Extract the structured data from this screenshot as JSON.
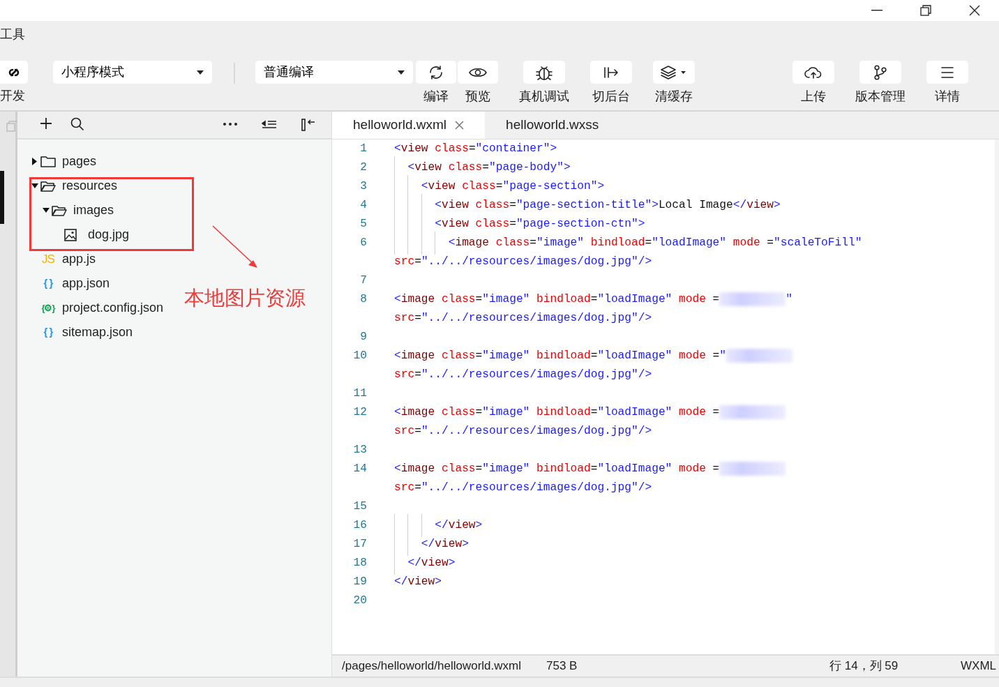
{
  "window": {
    "title": "工具"
  },
  "toolbar": {
    "left_label": "开发",
    "dropdowns": [
      {
        "kind": "mode",
        "value": "小程序模式"
      },
      {
        "kind": "compile",
        "value": "普通编译"
      }
    ],
    "buttons": [
      {
        "kind": "refresh",
        "label": "编译"
      },
      {
        "kind": "eye",
        "label": "预览"
      },
      {
        "kind": "bug",
        "label": "真机调试"
      },
      {
        "kind": "switch",
        "label": "切后台"
      },
      {
        "kind": "layers",
        "label": "清缓存"
      },
      {
        "kind": "cloud",
        "label": "上传"
      },
      {
        "kind": "branch",
        "label": "版本管理"
      },
      {
        "kind": "menu",
        "label": "详情"
      }
    ]
  },
  "file_tree": [
    {
      "kind": "folder",
      "label": "pages",
      "expanded": false
    },
    {
      "kind": "folder",
      "label": "resources",
      "expanded": true,
      "children": [
        {
          "kind": "folder",
          "label": "images",
          "expanded": true,
          "children": [
            {
              "kind": "image",
              "label": "dog.jpg"
            }
          ]
        }
      ]
    },
    {
      "kind": "js",
      "icon_text": "JS",
      "label": "app.js"
    },
    {
      "kind": "json",
      "icon_text": "{ }",
      "label": "app.json"
    },
    {
      "kind": "config",
      "icon_text": "{⚙}",
      "label": "project.config.json"
    },
    {
      "kind": "json",
      "icon_text": "{ }",
      "label": "sitemap.json"
    }
  ],
  "annotation": {
    "label": "本地图片资源"
  },
  "tabs": [
    {
      "label": "helloworld.wxml",
      "selected": true
    },
    {
      "label": "helloworld.wxss",
      "selected": false
    }
  ],
  "code_lines": [
    {
      "number": "1",
      "tokens": [
        {
          "kind": "bracket",
          "text": "<"
        },
        {
          "kind": "tag",
          "text": "view"
        },
        {
          "kind": "attr",
          "text": " class"
        },
        {
          "kind": "plain",
          "text": "="
        },
        {
          "kind": "string",
          "text": "\"container\""
        },
        {
          "kind": "bracket",
          "text": ">"
        }
      ]
    },
    {
      "number": "2",
      "tokens": [
        {
          "kind": "bracket",
          "text": "  <"
        },
        {
          "kind": "tag",
          "text": "view"
        },
        {
          "kind": "attr",
          "text": " class"
        },
        {
          "kind": "plain",
          "text": "="
        },
        {
          "kind": "string",
          "text": "\"page-body\""
        },
        {
          "kind": "bracket",
          "text": ">"
        }
      ]
    },
    {
      "number": "3",
      "tokens": [
        {
          "kind": "bracket",
          "text": "    <"
        },
        {
          "kind": "tag",
          "text": "view"
        },
        {
          "kind": "attr",
          "text": " class"
        },
        {
          "kind": "plain",
          "text": "="
        },
        {
          "kind": "string",
          "text": "\"page-section\""
        },
        {
          "kind": "bracket",
          "text": ">"
        }
      ]
    },
    {
      "number": "4",
      "tokens": [
        {
          "kind": "bracket",
          "text": "      <"
        },
        {
          "kind": "tag",
          "text": "view"
        },
        {
          "kind": "attr",
          "text": " class"
        },
        {
          "kind": "plain",
          "text": "="
        },
        {
          "kind": "string",
          "text": "\"page-section-title\""
        },
        {
          "kind": "bracket",
          "text": ">"
        },
        {
          "kind": "plain",
          "text": "Local Image"
        },
        {
          "kind": "bracket",
          "text": "</"
        },
        {
          "kind": "tag",
          "text": "view"
        },
        {
          "kind": "bracket",
          "text": ">"
        }
      ]
    },
    {
      "number": "5",
      "tokens": [
        {
          "kind": "bracket",
          "text": "      <"
        },
        {
          "kind": "tag",
          "text": "view"
        },
        {
          "kind": "attr",
          "text": " class"
        },
        {
          "kind": "plain",
          "text": "="
        },
        {
          "kind": "string",
          "text": "\"page-section-ctn\""
        },
        {
          "kind": "bracket",
          "text": ">"
        }
      ]
    },
    {
      "number": "6",
      "tokens": [
        {
          "kind": "bracket",
          "text": "        <"
        },
        {
          "kind": "tag",
          "text": "image"
        },
        {
          "kind": "attr",
          "text": " class"
        },
        {
          "kind": "plain",
          "text": "="
        },
        {
          "kind": "string",
          "text": "\"image\""
        },
        {
          "kind": "attr",
          "text": " bindload"
        },
        {
          "kind": "plain",
          "text": "="
        },
        {
          "kind": "string",
          "text": "\"loadImage\""
        },
        {
          "kind": "attr",
          "text": " mode"
        },
        {
          "kind": "plain",
          "text": " ="
        },
        {
          "kind": "string",
          "text": "\"scaleToFill\""
        }
      ]
    },
    {
      "tokens": [
        {
          "kind": "attr",
          "text": "src"
        },
        {
          "kind": "plain",
          "text": "="
        },
        {
          "kind": "string",
          "text": "\"../../resources/images/dog.jpg\""
        },
        {
          "kind": "bracket",
          "text": "/>"
        }
      ]
    },
    {
      "number": "7"
    },
    {
      "number": "8",
      "tokens": [
        {
          "kind": "bracket",
          "text": "<"
        },
        {
          "kind": "tag",
          "text": "image"
        },
        {
          "kind": "attr",
          "text": " class"
        },
        {
          "kind": "plain",
          "text": "="
        },
        {
          "kind": "string",
          "text": "\"image\""
        },
        {
          "kind": "attr",
          "text": " bindload"
        },
        {
          "kind": "plain",
          "text": "="
        },
        {
          "kind": "string",
          "text": "\"loadImage\""
        },
        {
          "kind": "attr",
          "text": " mode"
        },
        {
          "kind": "plain",
          "text": " ="
        },
        {
          "kind": "redacted"
        },
        {
          "kind": "string",
          "text": "\""
        }
      ]
    },
    {
      "tokens": [
        {
          "kind": "attr",
          "text": "src"
        },
        {
          "kind": "plain",
          "text": "="
        },
        {
          "kind": "string",
          "text": "\"../../resources/images/dog.jpg\""
        },
        {
          "kind": "bracket",
          "text": "/>"
        }
      ]
    },
    {
      "number": "9"
    },
    {
      "number": "10",
      "tokens": [
        {
          "kind": "bracket",
          "text": "<"
        },
        {
          "kind": "tag",
          "text": "image"
        },
        {
          "kind": "attr",
          "text": " class"
        },
        {
          "kind": "plain",
          "text": "="
        },
        {
          "kind": "string",
          "text": "\"image\""
        },
        {
          "kind": "attr",
          "text": " bindload"
        },
        {
          "kind": "plain",
          "text": "="
        },
        {
          "kind": "string",
          "text": "\"loadImage\""
        },
        {
          "kind": "attr",
          "text": " mode"
        },
        {
          "kind": "plain",
          "text": " ="
        },
        {
          "kind": "string",
          "text": "\""
        },
        {
          "kind": "redacted"
        }
      ]
    },
    {
      "tokens": [
        {
          "kind": "attr",
          "text": "src"
        },
        {
          "kind": "plain",
          "text": "="
        },
        {
          "kind": "string",
          "text": "\"../../resources/images/dog.jpg\""
        },
        {
          "kind": "bracket",
          "text": "/>"
        }
      ]
    },
    {
      "number": "11"
    },
    {
      "number": "12",
      "tokens": [
        {
          "kind": "bracket",
          "text": "<"
        },
        {
          "kind": "tag",
          "text": "image"
        },
        {
          "kind": "attr",
          "text": " class"
        },
        {
          "kind": "plain",
          "text": "="
        },
        {
          "kind": "string",
          "text": "\"image\""
        },
        {
          "kind": "attr",
          "text": " bindload"
        },
        {
          "kind": "plain",
          "text": "="
        },
        {
          "kind": "string",
          "text": "\"loadImage\""
        },
        {
          "kind": "attr",
          "text": " mode"
        },
        {
          "kind": "plain",
          "text": " ="
        },
        {
          "kind": "redacted"
        }
      ]
    },
    {
      "tokens": [
        {
          "kind": "attr",
          "text": "src"
        },
        {
          "kind": "plain",
          "text": "="
        },
        {
          "kind": "string",
          "text": "\"../../resources/images/dog.jpg\""
        },
        {
          "kind": "bracket",
          "text": "/>"
        }
      ]
    },
    {
      "number": "13"
    },
    {
      "number": "14",
      "tokens": [
        {
          "kind": "bracket",
          "text": "<"
        },
        {
          "kind": "tag",
          "text": "image"
        },
        {
          "kind": "attr",
          "text": " class"
        },
        {
          "kind": "plain",
          "text": "="
        },
        {
          "kind": "string",
          "text": "\"image\""
        },
        {
          "kind": "attr",
          "text": " bindload"
        },
        {
          "kind": "plain",
          "text": "="
        },
        {
          "kind": "string",
          "text": "\"loadImage\""
        },
        {
          "kind": "attr",
          "text": " mode"
        },
        {
          "kind": "plain",
          "text": " ="
        },
        {
          "kind": "redacted"
        }
      ]
    },
    {
      "tokens": [
        {
          "kind": "attr",
          "text": "src"
        },
        {
          "kind": "plain",
          "text": "="
        },
        {
          "kind": "string",
          "text": "\"../../resources/images/dog.jpg\""
        },
        {
          "kind": "bracket",
          "text": "/>"
        }
      ]
    },
    {
      "number": "15"
    },
    {
      "number": "16",
      "tokens": [
        {
          "kind": "bracket",
          "text": "      </"
        },
        {
          "kind": "tag",
          "text": "view"
        },
        {
          "kind": "bracket",
          "text": ">"
        }
      ]
    },
    {
      "number": "17",
      "tokens": [
        {
          "kind": "bracket",
          "text": "    </"
        },
        {
          "kind": "tag",
          "text": "view"
        },
        {
          "kind": "bracket",
          "text": ">"
        }
      ]
    },
    {
      "number": "18",
      "tokens": [
        {
          "kind": "bracket",
          "text": "  </"
        },
        {
          "kind": "tag",
          "text": "view"
        },
        {
          "kind": "bracket",
          "text": ">"
        }
      ]
    },
    {
      "number": "19",
      "tokens": [
        {
          "kind": "bracket",
          "text": "</"
        },
        {
          "kind": "tag",
          "text": "view"
        },
        {
          "kind": "bracket",
          "text": ">"
        }
      ]
    },
    {
      "number": "20"
    }
  ],
  "status_bar": {
    "path": "/pages/helloworld/helloworld.wxml",
    "size": "753 B",
    "position": "行 14，列 59",
    "language": "WXML"
  }
}
